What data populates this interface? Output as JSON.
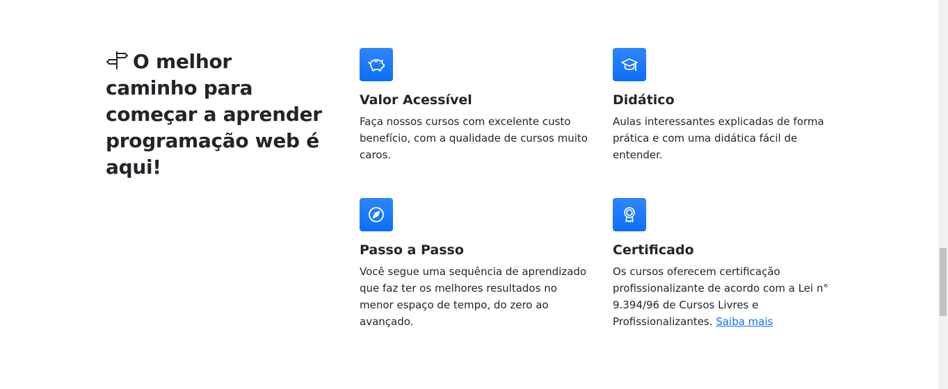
{
  "section": {
    "heading": "O melhor caminho para começar a aprender programação web é aqui!",
    "heading_icon": "signpost-icon"
  },
  "features": [
    {
      "icon": "piggy-bank-icon",
      "title": "Valor Acessível",
      "text": "Faça nossos cursos com excelente custo benefício, com a qualidade de cursos muito caros."
    },
    {
      "icon": "graduation-cap-icon",
      "title": "Didático",
      "text": "Aulas interessantes explicadas de forma prática e com uma didática fácil de entender."
    },
    {
      "icon": "compass-icon",
      "title": "Passo a Passo",
      "text": "Você segue uma sequência de aprendizado que faz ter os melhores resultados no menor espaço de tempo, do zero ao avançado."
    },
    {
      "icon": "award-icon",
      "title": "Certificado",
      "text": "Os cursos oferecem certificação profissionalizante de acordo com a Lei n° 9.394/96 de Cursos Livres e Profissionalizantes.",
      "link": "Saiba mais"
    }
  ],
  "colors": {
    "accent": "#0d6efd",
    "text": "#212529",
    "background": "#ffffff"
  }
}
